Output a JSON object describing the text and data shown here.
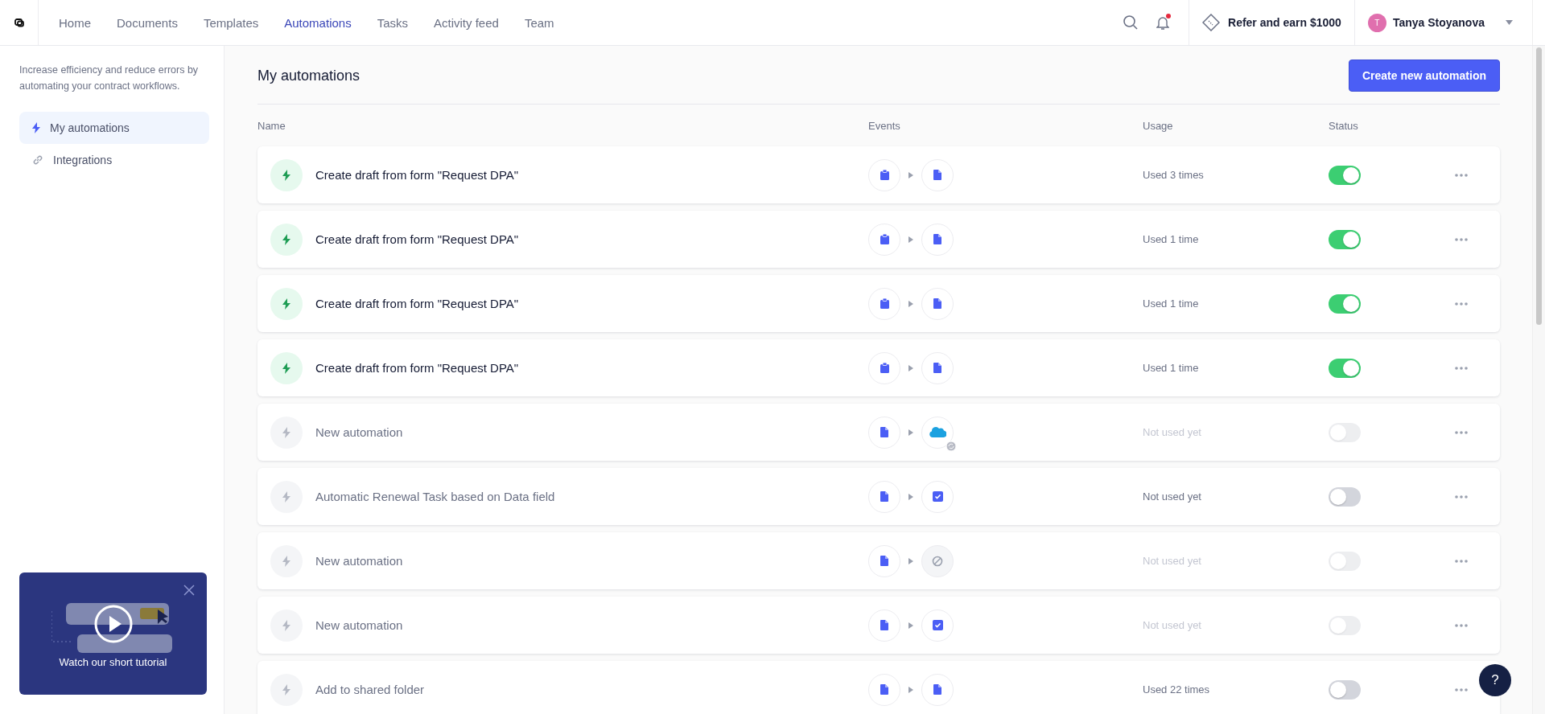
{
  "nav": {
    "items": [
      {
        "label": "Home",
        "selected": false
      },
      {
        "label": "Documents",
        "selected": false
      },
      {
        "label": "Templates",
        "selected": false
      },
      {
        "label": "Automations",
        "selected": true
      },
      {
        "label": "Tasks",
        "selected": false
      },
      {
        "label": "Activity feed",
        "selected": false
      },
      {
        "label": "Team",
        "selected": false
      }
    ],
    "notifications_unread": true,
    "referral": "Refer and earn $1000",
    "user": {
      "initial": "T",
      "name": "Tanya Stoyanova"
    }
  },
  "sidebar": {
    "description": "Increase efficiency and reduce errors by automating your contract workflows.",
    "items": [
      {
        "label": "My automations",
        "kind": "bolt",
        "selected": true
      },
      {
        "label": "Integrations",
        "kind": "link",
        "selected": false
      }
    ],
    "tutorial": {
      "label": "Watch our short tutorial"
    }
  },
  "page": {
    "title": "My automations",
    "create_button": "Create new automation"
  },
  "table": {
    "columns": [
      "Name",
      "Events",
      "Usage",
      "Status"
    ],
    "rows": [
      {
        "name": "Create draft from form \"Request DPA\"",
        "active": true,
        "events": [
          {
            "kind": "form"
          },
          {
            "kind": "document"
          }
        ],
        "usage": "Used 3 times",
        "on": true,
        "disabled": false
      },
      {
        "name": "Create draft from form \"Request DPA\"",
        "active": true,
        "events": [
          {
            "kind": "form"
          },
          {
            "kind": "document"
          }
        ],
        "usage": "Used 1 time",
        "on": true,
        "disabled": false
      },
      {
        "name": "Create draft from form \"Request DPA\"",
        "active": true,
        "events": [
          {
            "kind": "form"
          },
          {
            "kind": "document"
          }
        ],
        "usage": "Used 1 time",
        "on": true,
        "disabled": false
      },
      {
        "name": "Create draft from form \"Request DPA\"",
        "active": true,
        "events": [
          {
            "kind": "form"
          },
          {
            "kind": "document"
          }
        ],
        "usage": "Used 1 time",
        "on": true,
        "disabled": false
      },
      {
        "name": "New automation",
        "active": false,
        "events": [
          {
            "kind": "document"
          },
          {
            "kind": "cloud"
          }
        ],
        "usage": "Not used yet",
        "on": false,
        "disabled": true
      },
      {
        "name": "Automatic Renewal Task based on Data field",
        "active": false,
        "events": [
          {
            "kind": "document"
          },
          {
            "kind": "task"
          }
        ],
        "usage": "Not used yet",
        "on": false,
        "disabled": false
      },
      {
        "name": "New automation",
        "active": false,
        "events": [
          {
            "kind": "document"
          },
          {
            "kind": "none"
          }
        ],
        "usage": "Not used yet",
        "on": false,
        "disabled": true
      },
      {
        "name": "New automation",
        "active": false,
        "events": [
          {
            "kind": "document"
          },
          {
            "kind": "task"
          }
        ],
        "usage": "Not used yet",
        "on": false,
        "disabled": true
      },
      {
        "name": "Add to shared folder",
        "active": false,
        "events": [
          {
            "kind": "document"
          },
          {
            "kind": "document"
          }
        ],
        "usage": "Used 22 times",
        "on": false,
        "disabled": false
      }
    ]
  },
  "help_button": "?"
}
